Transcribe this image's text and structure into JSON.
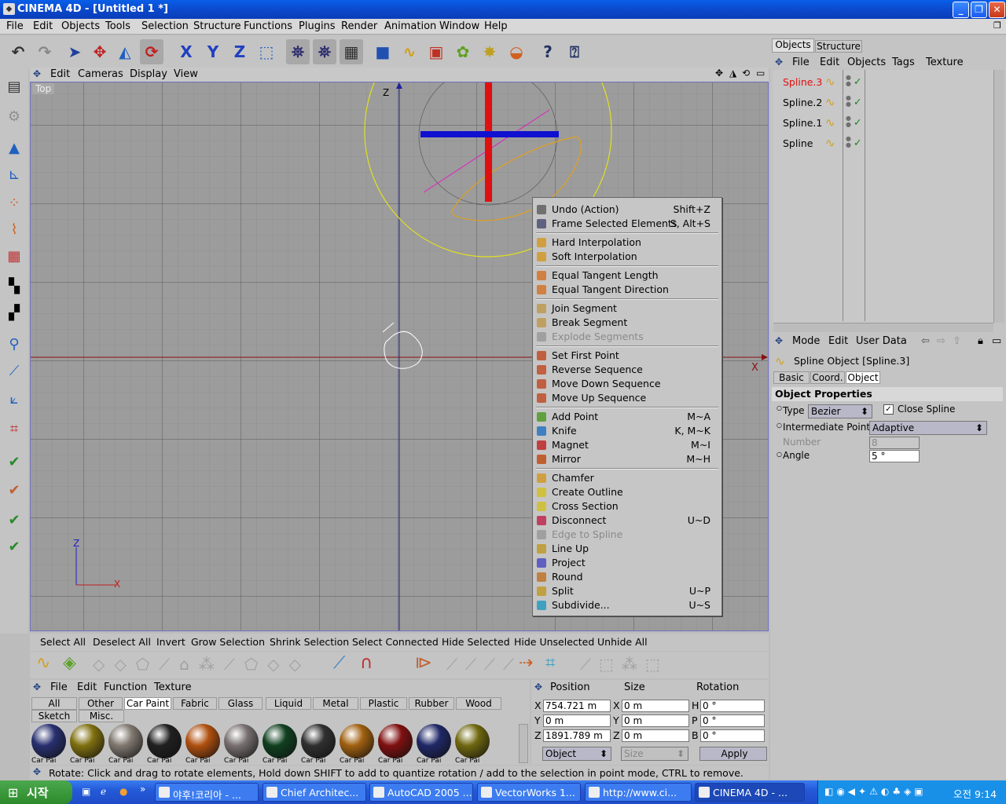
{
  "window": {
    "title": "CINEMA 4D - [Untitled 1 *]"
  },
  "menu": [
    "File",
    "Edit",
    "Objects",
    "Tools",
    "Selection",
    "Structure",
    "Functions",
    "Plugins",
    "Render",
    "Animation",
    "Window",
    "Help"
  ],
  "viewport": {
    "menu": [
      "Edit",
      "Cameras",
      "Display",
      "View"
    ],
    "label": "Top",
    "axis_z": "Z",
    "axis_x": "X",
    "gizmo_z": "Z",
    "gizmo_x": "X"
  },
  "context_menu": [
    {
      "label": "Undo (Action)",
      "shortcut": "Shift+Z",
      "disabled": false,
      "icon_color": "#707070"
    },
    {
      "label": "Frame Selected Elements",
      "shortcut": "S, Alt+S",
      "disabled": false,
      "icon_color": "#606080"
    },
    {
      "label": "Hard Interpolation",
      "shortcut": "",
      "disabled": false,
      "icon_color": "#d0a040"
    },
    {
      "label": "Soft Interpolation",
      "shortcut": "",
      "disabled": false,
      "icon_color": "#d0a040"
    },
    {
      "label": "Equal Tangent Length",
      "shortcut": "",
      "disabled": false,
      "icon_color": "#d08040"
    },
    {
      "label": "Equal Tangent Direction",
      "shortcut": "",
      "disabled": false,
      "icon_color": "#d08040"
    },
    {
      "label": "Join Segment",
      "shortcut": "",
      "disabled": false,
      "icon_color": "#c0a060"
    },
    {
      "label": "Break Segment",
      "shortcut": "",
      "disabled": false,
      "icon_color": "#c0a060"
    },
    {
      "label": "Explode Segments",
      "shortcut": "",
      "disabled": true,
      "icon_color": "#a0a0a0"
    },
    {
      "label": "Set First Point",
      "shortcut": "",
      "disabled": false,
      "icon_color": "#c06040"
    },
    {
      "label": "Reverse Sequence",
      "shortcut": "",
      "disabled": false,
      "icon_color": "#c06040"
    },
    {
      "label": "Move Down Sequence",
      "shortcut": "",
      "disabled": false,
      "icon_color": "#c06040"
    },
    {
      "label": "Move Up Sequence",
      "shortcut": "",
      "disabled": false,
      "icon_color": "#c06040"
    },
    {
      "label": "Add Point",
      "shortcut": "M~A",
      "disabled": false,
      "icon_color": "#60a040"
    },
    {
      "label": "Knife",
      "shortcut": "K, M~K",
      "disabled": false,
      "icon_color": "#4080c0"
    },
    {
      "label": "Magnet",
      "shortcut": "M~I",
      "disabled": false,
      "icon_color": "#c04040"
    },
    {
      "label": "Mirror",
      "shortcut": "M~H",
      "disabled": false,
      "icon_color": "#c06030"
    },
    {
      "label": "Chamfer",
      "shortcut": "",
      "disabled": false,
      "icon_color": "#d0a040"
    },
    {
      "label": "Create Outline",
      "shortcut": "",
      "disabled": false,
      "icon_color": "#d0c040"
    },
    {
      "label": "Cross Section",
      "shortcut": "",
      "disabled": false,
      "icon_color": "#d0c040"
    },
    {
      "label": "Disconnect",
      "shortcut": "U~D",
      "disabled": false,
      "icon_color": "#c04060"
    },
    {
      "label": "Edge to Spline",
      "shortcut": "",
      "disabled": true,
      "icon_color": "#a0a0a0"
    },
    {
      "label": "Line Up",
      "shortcut": "",
      "disabled": false,
      "icon_color": "#c0a040"
    },
    {
      "label": "Project",
      "shortcut": "",
      "disabled": false,
      "icon_color": "#6060c0"
    },
    {
      "label": "Round",
      "shortcut": "",
      "disabled": false,
      "icon_color": "#c08040"
    },
    {
      "label": "Split",
      "shortcut": "U~P",
      "disabled": false,
      "icon_color": "#c0a040"
    },
    {
      "label": "Subdivide...",
      "shortcut": "U~S",
      "disabled": false,
      "icon_color": "#40a0c0"
    }
  ],
  "selection_bar": [
    "Select All",
    "Deselect All",
    "Invert",
    "Grow Selection",
    "Shrink Selection",
    "Select Connected",
    "Hide Selected",
    "Hide Unselected",
    "Unhide All"
  ],
  "materials": {
    "menu": [
      "File",
      "Edit",
      "Function",
      "Texture"
    ],
    "tabs_row1": [
      "All",
      "Other",
      "Car Paint",
      "Fabric",
      "Glass",
      "Liquid",
      "Metal",
      "Plastic",
      "Rubber",
      "Wood"
    ],
    "tabs_row2": [
      "Sketch",
      "Misc."
    ],
    "active_tab": "Car Paint",
    "ball_label": "Car Pai",
    "balls": [
      "#283070",
      "#807010",
      "#807870",
      "#202020",
      "#b05010",
      "#787070",
      "#104020",
      "#303030",
      "#a06010",
      "#801010",
      "#202868",
      "#706810"
    ]
  },
  "coords": {
    "headers": {
      "position": "Position",
      "size": "Size",
      "rotation": "Rotation"
    },
    "rows": [
      {
        "axis": "X",
        "pos": "754.721 m",
        "saxis": "X",
        "size": "0 m",
        "raxis": "H",
        "rot": "0 °"
      },
      {
        "axis": "Y",
        "pos": "0 m",
        "saxis": "Y",
        "size": "0 m",
        "raxis": "P",
        "rot": "0 °"
      },
      {
        "axis": "Z",
        "pos": "1891.789 m",
        "saxis": "Z",
        "size": "0 m",
        "raxis": "B",
        "rot": "0 °"
      }
    ],
    "mode": "Object",
    "size_mode": "Size",
    "apply": "Apply"
  },
  "status": "Rotate: Click and drag to rotate elements, Hold down SHIFT to add to quantize rotation / add to the selection in point mode, CTRL to remove.",
  "objects_panel": {
    "tabs": [
      "Objects",
      "Structure"
    ],
    "menu": [
      "File",
      "Edit",
      "Objects",
      "Tags",
      "Texture"
    ],
    "items": [
      {
        "name": "Spline.3",
        "selected": true
      },
      {
        "name": "Spline.2",
        "selected": false
      },
      {
        "name": "Spline.1",
        "selected": false
      },
      {
        "name": "Spline",
        "selected": false
      }
    ]
  },
  "attributes": {
    "menu": [
      "Mode",
      "Edit",
      "User Data"
    ],
    "object_title": "Spline Object [Spline.3]",
    "tabs": [
      "Basic",
      "Coord.",
      "Object"
    ],
    "section": "Object Properties",
    "type_label": "Type",
    "type_value": "Bezier",
    "close_spline": "Close Spline",
    "interp_label": "Intermediate Points",
    "interp_value": "Adaptive",
    "number_label": "Number",
    "number_value": "8",
    "angle_label": "Angle",
    "angle_value": "5 °"
  },
  "taskbar": {
    "start": "시작",
    "tasks": [
      "야후!코리아 - ...",
      "Chief Architec...",
      "AutoCAD 2005 ...",
      "VectorWorks 1...",
      "http://www.ci...",
      "CINEMA 4D - ..."
    ],
    "time": "오전 9:14"
  }
}
